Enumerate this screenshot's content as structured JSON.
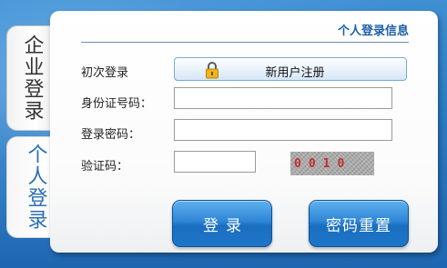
{
  "tabs": {
    "company": "企业登录",
    "personal": "个人登录"
  },
  "panel": {
    "title": "个人登录信息"
  },
  "form": {
    "first_login_label": "初次登录",
    "register_button": "新用户注册",
    "id_label": "身份证号码：",
    "id_value": "",
    "password_label": "登录密码：",
    "password_value": "",
    "captcha_label": "验证码：",
    "captcha_value": "",
    "captcha_image_text": "0010"
  },
  "buttons": {
    "login": "登录",
    "reset": "密码重置"
  },
  "colors": {
    "accent": "#1c5fa6",
    "background": "#2c7cc4",
    "captcha_digits": "#c0302a"
  },
  "icons": {
    "register": "lock-icon"
  }
}
